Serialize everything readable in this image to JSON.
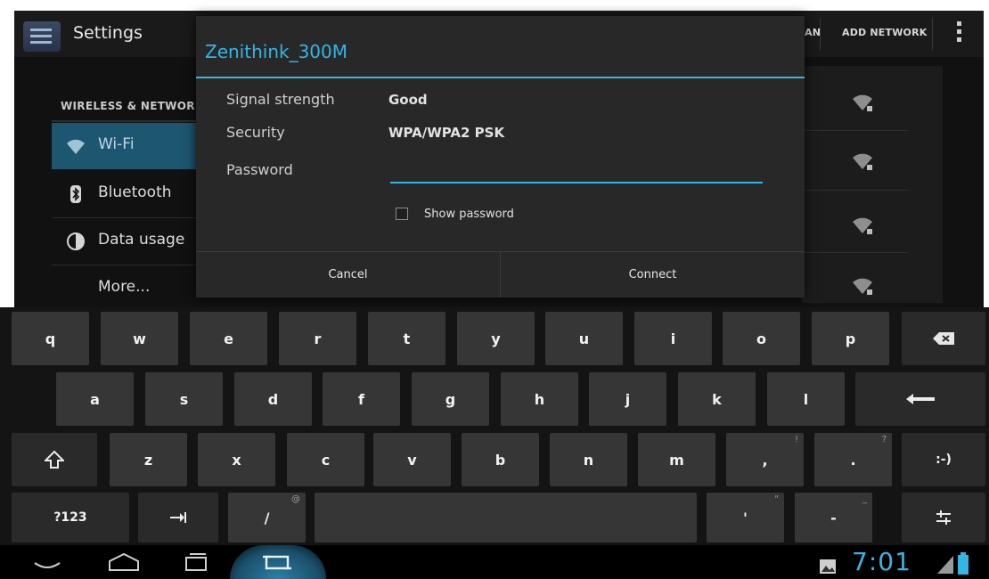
{
  "action_bar": {
    "title": "Settings",
    "actions": [
      "AN",
      "ADD NETWORK"
    ]
  },
  "sidebar": {
    "section_header": "WIRELESS & NETWOR",
    "items": [
      {
        "label": "Wi-Fi",
        "icon": "wifi-icon",
        "selected": true
      },
      {
        "label": "Bluetooth",
        "icon": "bluetooth-icon",
        "selected": false
      },
      {
        "label": "Data usage",
        "icon": "data-usage-icon",
        "selected": false
      },
      {
        "label": "More...",
        "icon": "",
        "selected": false
      }
    ]
  },
  "network_list": {
    "icons": [
      "wifi-locked-icon",
      "wifi-locked-icon",
      "wifi-locked-icon",
      "wifi-locked-icon"
    ]
  },
  "dialog": {
    "title": "Zenithink_300M",
    "fields": [
      {
        "label": "Signal strength",
        "value": "Good"
      },
      {
        "label": "Security",
        "value": "WPA/WPA2 PSK"
      }
    ],
    "password_label": "Password",
    "password_value": "",
    "show_password_label": "Show password",
    "show_password_checked": false,
    "cancel_label": "Cancel",
    "connect_label": "Connect"
  },
  "keyboard": {
    "row1": [
      "q",
      "w",
      "e",
      "r",
      "t",
      "y",
      "u",
      "i",
      "o",
      "p"
    ],
    "row2": [
      "a",
      "s",
      "d",
      "f",
      "g",
      "h",
      "j",
      "k",
      "l"
    ],
    "row3": [
      "z",
      "x",
      "c",
      "v",
      "b",
      "n",
      "m"
    ],
    "row3_punct": [
      {
        "label": ",",
        "hint": "!"
      },
      {
        "label": ".",
        "hint": "?"
      }
    ],
    "smiley_label": ":-)",
    "symbols_label": "?123",
    "slash_label": "/",
    "slash_hint": "@",
    "apostrophe_label": "'",
    "apostrophe_hint": "\"",
    "dash_label": "-",
    "dash_hint": "_",
    "icons": {
      "backspace": "backspace-icon",
      "enter": "enter-icon",
      "shift": "shift-icon",
      "tab": "tab-icon",
      "settings": "keyboard-settings-icon"
    }
  },
  "system_bar": {
    "clock": "7:01",
    "colors": {
      "accent": "#33b5e5"
    }
  }
}
